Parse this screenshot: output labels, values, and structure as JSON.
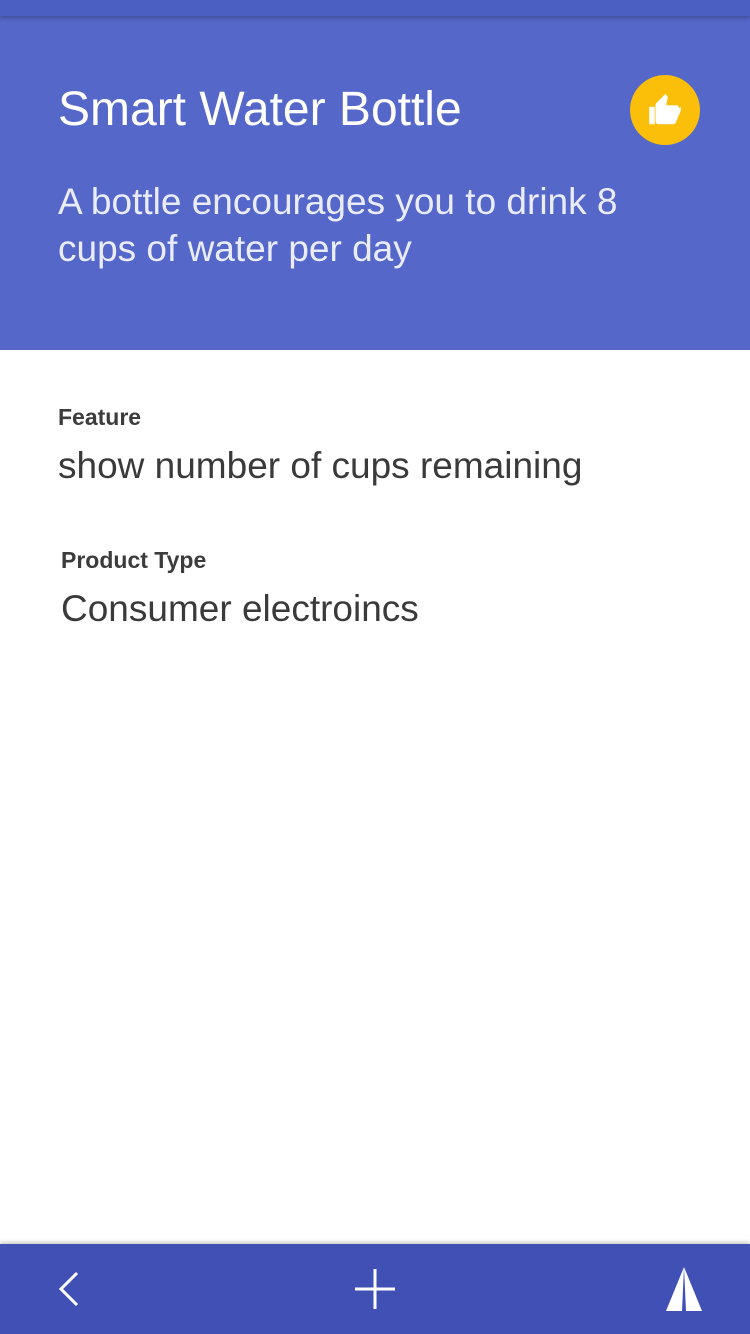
{
  "header": {
    "title": "Smart Water Bottle",
    "subtitle": "A bottle encourages you to drink 8 cups of water per day",
    "like_icon": "thumbs-up-icon"
  },
  "fields": {
    "feature": {
      "label": "Feature",
      "value": "show number of cups remaining"
    },
    "product_type": {
      "label": "Product Type",
      "value": "Consumer electroincs"
    }
  },
  "bottom_bar": {
    "back_icon": "chevron-left-icon",
    "add_icon": "plus-icon",
    "navigate_icon": "navigation-arrow-icon"
  },
  "colors": {
    "header": "#5567c8",
    "bottom_bar": "#4050b5",
    "accent": "#fbbf0a"
  }
}
